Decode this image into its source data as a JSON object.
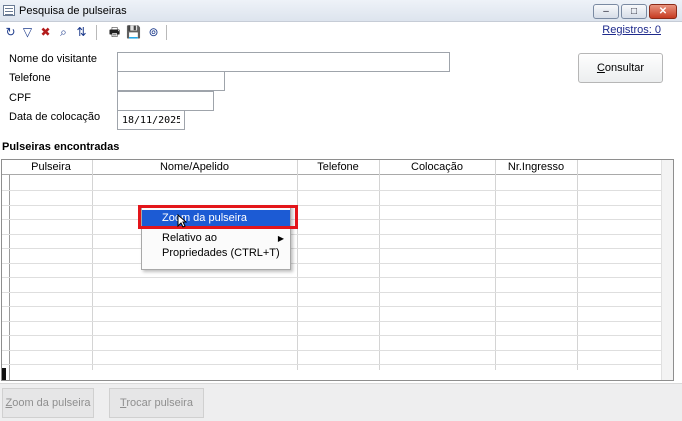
{
  "window": {
    "title": "Pesquisa de pulseiras",
    "controls": {
      "minimize": "–",
      "restore": "□",
      "close": "✕"
    }
  },
  "toolbar": {
    "icons": [
      "refresh-icon",
      "filter-icon",
      "clear-filter-icon",
      "search-icon",
      "sort-icon",
      "print-icon",
      "save-icon",
      "calendar-icon"
    ],
    "glyphs": [
      "↻",
      "▽",
      "✖",
      "⌕",
      "⇅",
      "🖶",
      "💾",
      "⊚"
    ],
    "registros_label": "Registros: 0"
  },
  "form": {
    "nome_label": "Nome do visitante",
    "nome_value": "",
    "telefone_label": "Telefone",
    "telefone_value": "",
    "cpf_label": "CPF",
    "cpf_value": "",
    "data_label": "Data de colocação",
    "data_value": "18/11/2025",
    "consultar_first": "C",
    "consultar_rest": "onsultar"
  },
  "results": {
    "section_title": "Pulseiras encontradas",
    "columns": [
      "Pulseira",
      "Nome/Apelido",
      "Telefone",
      "Colocação",
      "Nr.Ingresso"
    ],
    "rows": []
  },
  "context_menu": {
    "items": [
      "Zoom da pulseira",
      "Relativo ao",
      "Propriedades (CTRL+T)"
    ],
    "submenu_arrow": "▶"
  },
  "bottom": {
    "zoom_first": "Z",
    "zoom_rest": "oom da pulseira",
    "trocar_first": "T",
    "trocar_rest": "rocar pulseira"
  },
  "colors": {
    "menu_highlight": "#1c5bd4",
    "annotation_red": "#e3151a",
    "link": "#1e2a8c"
  }
}
